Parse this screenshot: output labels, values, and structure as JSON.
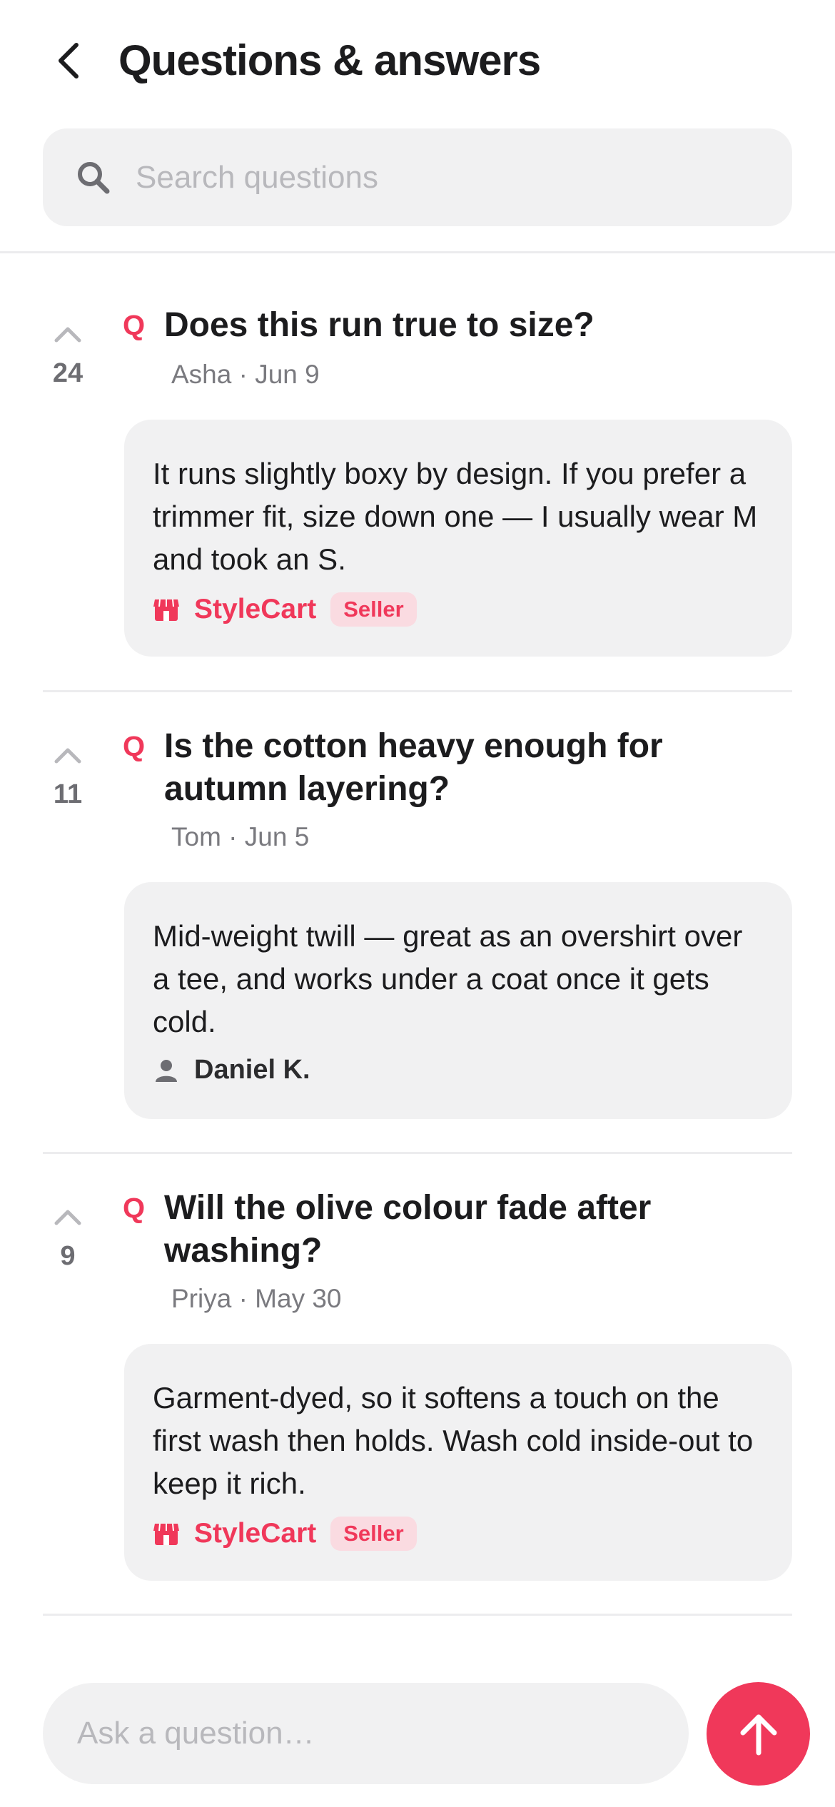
{
  "header": {
    "title": "Questions & answers",
    "back_icon": "back-arrow-icon"
  },
  "search": {
    "placeholder": "Search questions",
    "icon": "search-icon"
  },
  "qa_items": [
    {
      "votes": "24",
      "q_mark": "Q",
      "question": "Does this run true to size?",
      "meta": "Asha · Jun 9",
      "answer": "It runs slightly boxy by design. If you prefer a trimmer fit, size down one — I usually wear M and took an S.",
      "author": "StyleCart",
      "author_type": "seller",
      "badge": "Seller"
    },
    {
      "votes": "11",
      "q_mark": "Q",
      "question": "Is the cotton heavy enough for autumn layering?",
      "meta": "Tom · Jun 5",
      "answer": "Mid-weight twill — great as an overshirt over a tee, and works under a coat once it gets cold.",
      "author": "Daniel K.",
      "author_type": "user"
    },
    {
      "votes": "9",
      "q_mark": "Q",
      "question": "Will the olive colour fade after washing?",
      "meta": "Priya · May 30",
      "answer": "Garment-dyed, so it softens a touch on the first wash then holds. Wash cold inside-out to keep it rich.",
      "author": "StyleCart",
      "author_type": "seller",
      "badge": "Seller"
    }
  ],
  "ask": {
    "placeholder": "Ask a question…",
    "send_icon": "arrow-up-icon"
  },
  "colors": {
    "accent": "#f0385a",
    "badge_bg": "#fadbe1",
    "card_bg": "#f1f1f2",
    "muted": "#7a7a7f"
  }
}
